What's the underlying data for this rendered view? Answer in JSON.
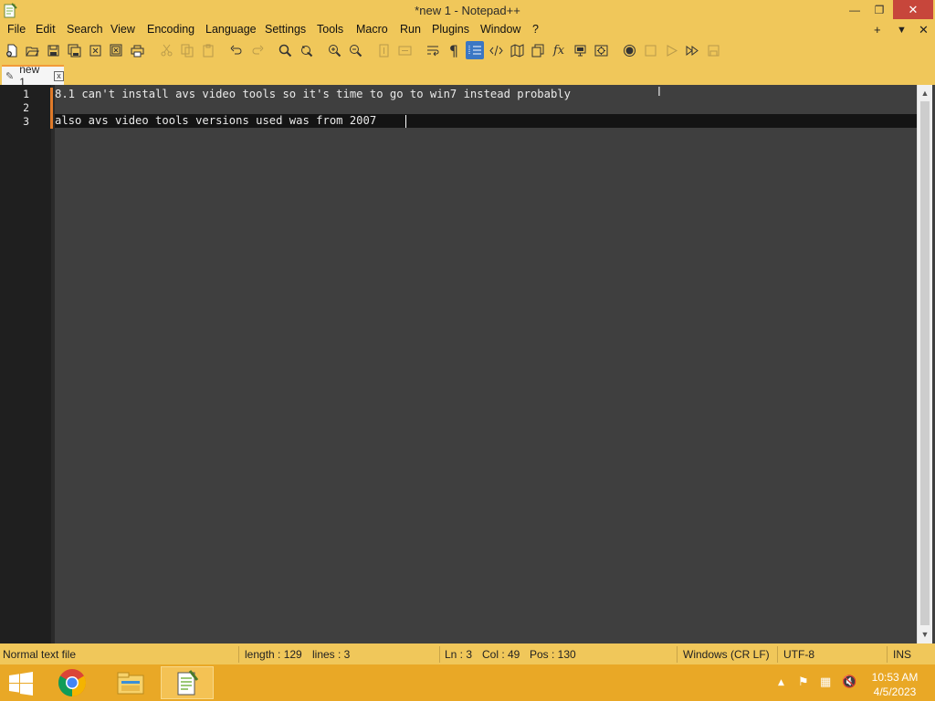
{
  "window": {
    "title": "*new 1 - Notepad++",
    "minimize_glyph": "—",
    "maximize_glyph": "❐",
    "close_glyph": "✕"
  },
  "menu": {
    "items": [
      "File",
      "Edit",
      "Search",
      "View",
      "Encoding",
      "Language",
      "Settings",
      "Tools",
      "Macro",
      "Run",
      "Plugins",
      "Window",
      "?"
    ],
    "right_add": "+",
    "right_dropdown": "▼",
    "right_close": "✕"
  },
  "toolbar": {
    "icons": [
      "new-file-icon",
      "open-file-icon",
      "save-icon",
      "save-all-icon",
      "close-icon",
      "close-all-icon",
      "print-icon",
      "cut-icon",
      "copy-icon",
      "paste-icon",
      "undo-icon",
      "redo-icon",
      "find-icon",
      "replace-icon",
      "zoom-in-icon",
      "zoom-out-icon",
      "sync-vertical-icon",
      "sync-horizontal-icon",
      "word-wrap-icon",
      "show-all-chars-icon",
      "indent-guide-icon",
      "xml-tag-icon",
      "document-map-icon",
      "function-list-icon",
      "folder-workspace-icon",
      "fx-icon",
      "monitor-icon",
      "record-macro-icon",
      "stop-record-icon",
      "play-macro-icon",
      "run-macro-multiple-icon",
      "save-macro-icon"
    ]
  },
  "tab": {
    "label": "new 1",
    "close_glyph": "x"
  },
  "editor": {
    "lines": [
      {
        "number": "1",
        "text": "8.1 can't install avs video tools so it's time to go to win7 instead probably"
      },
      {
        "number": "2",
        "text": ""
      },
      {
        "number": "3",
        "text": "also avs video tools versions used was from 2007"
      }
    ],
    "cursor_glyph": "I"
  },
  "statusbar": {
    "file_type": "Normal text file",
    "length": "length : 129",
    "lines": "lines : 3",
    "ln": "Ln : 3",
    "col": "Col : 49",
    "pos": "Pos : 130",
    "eol": "Windows (CR LF)",
    "encoding": "UTF-8",
    "mode": "INS"
  },
  "taskbar": {
    "clock_time": "10:53 AM",
    "clock_date": "4/5/2023",
    "tray_up": "▲"
  },
  "colors": {
    "accent": "#f0c75a",
    "taskbar": "#e9a826",
    "editor_bg": "#3f3f3f",
    "gutter_bg": "#1f1f1f",
    "close_red": "#c7463b"
  }
}
